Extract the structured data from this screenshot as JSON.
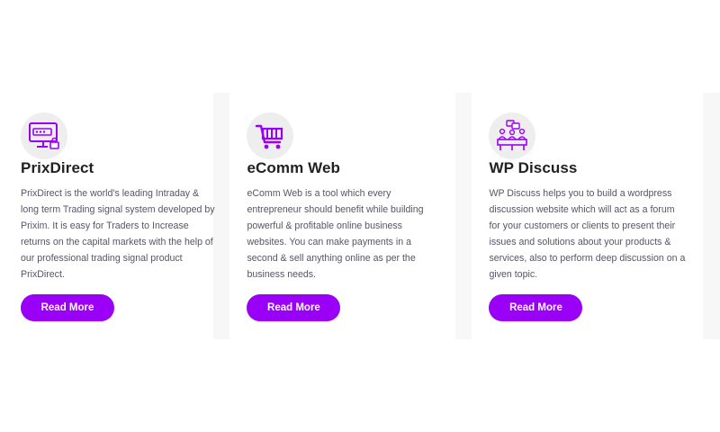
{
  "accent_color": "#9a00f5",
  "cards": [
    {
      "icon": "monitor-password-lock-icon",
      "title": "PrixDirect",
      "description": "PrixDirect is the world's leading Intraday & long term Trading signal system developed by Prixim. It is easy for Traders to Increase returns on the capital markets with the help of our professional trading signal product PrixDirect.",
      "button_label": "Read More"
    },
    {
      "icon": "shopping-cart-icon",
      "title": "eComm Web",
      "description": "eComm Web is a tool which every entrepreneur should benefit while building powerful & profitable online business websites. You can make payments in a second & sell anything online as per the business needs.",
      "button_label": "Read More"
    },
    {
      "icon": "discussion-group-icon",
      "title": "WP Discuss",
      "description": "WP Discuss helps you to build a wordpress discussion website which will act as a forum for your customers or clients to present their issues and solutions about your products & services, also to perform deep discussion on a given topic.",
      "button_label": "Read More"
    }
  ]
}
